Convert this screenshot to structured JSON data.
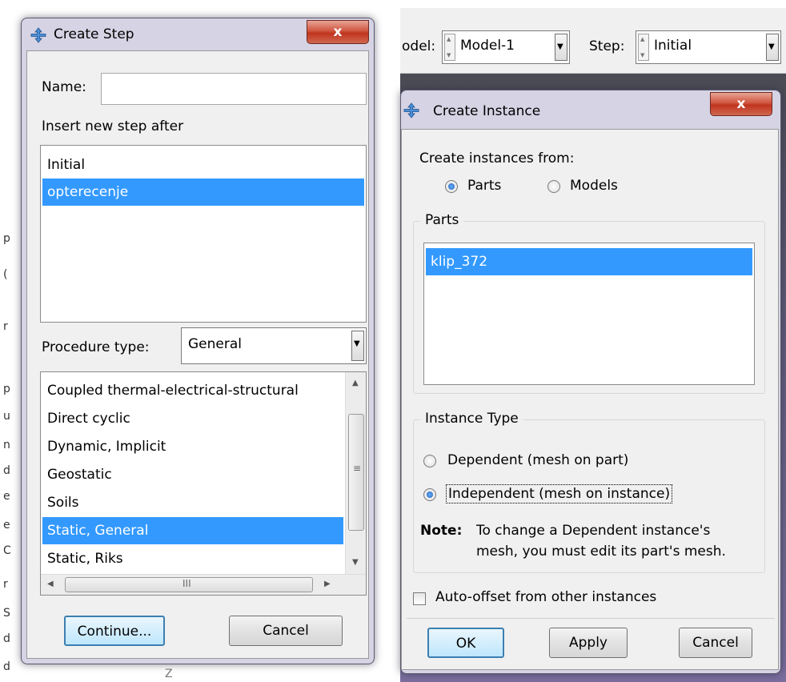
{
  "create_step": {
    "title": "Create Step",
    "close_label": "x",
    "name_label": "Name:",
    "name_value": "",
    "insert_after_label": "Insert new step after",
    "steps": [
      {
        "label": "Initial",
        "selected": false
      },
      {
        "label": "opterecenje",
        "selected": true
      }
    ],
    "procedure_type_label": "Procedure type:",
    "procedure_type_value": "General",
    "procedures": [
      {
        "label": "Coupled thermal-electrical-structural",
        "selected": false
      },
      {
        "label": "Direct cyclic",
        "selected": false
      },
      {
        "label": "Dynamic, Implicit",
        "selected": false
      },
      {
        "label": "Geostatic",
        "selected": false
      },
      {
        "label": "Soils",
        "selected": false
      },
      {
        "label": "Static, General",
        "selected": true
      },
      {
        "label": "Static, Riks",
        "selected": false
      }
    ],
    "continue_label": "Continue...",
    "cancel_label": "Cancel"
  },
  "toolbar": {
    "model_label": "odel:",
    "model_value": "Model-1",
    "step_label": "Step:",
    "step_value": "Initial"
  },
  "create_instance": {
    "title": "Create Instance",
    "close_label": "x",
    "create_from_label": "Create instances from:",
    "source_options": [
      {
        "label": "Parts",
        "checked": true
      },
      {
        "label": "Models",
        "checked": false
      }
    ],
    "parts_group_label": "Parts",
    "parts": [
      {
        "label": "klip_372",
        "selected": true
      }
    ],
    "instance_type_label": "Instance Type",
    "instance_types": [
      {
        "label": "Dependent (mesh on part)",
        "checked": false
      },
      {
        "label": "Independent (mesh on instance)",
        "checked": true
      }
    ],
    "note_label": "Note:",
    "note_line1": "To change a Dependent instance's",
    "note_line2": "mesh, you must edit its part's mesh.",
    "auto_offset_label": "Auto-offset from other instances",
    "auto_offset_checked": false,
    "ok_label": "OK",
    "apply_label": "Apply",
    "cancel_label": "Cancel"
  },
  "background": {
    "axis_label": "Z",
    "left_strip_chars": [
      "p",
      "(",
      "r",
      "p",
      "u",
      "n",
      "d",
      "e",
      "e",
      "C",
      "r",
      "S",
      "d",
      "d"
    ]
  }
}
